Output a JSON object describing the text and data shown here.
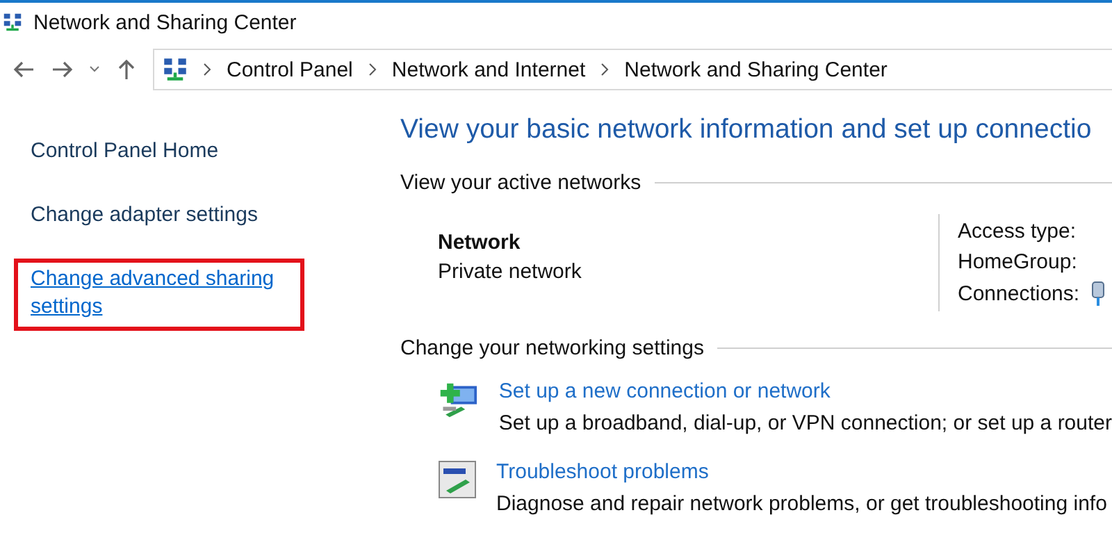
{
  "window": {
    "title": "Network and Sharing Center"
  },
  "breadcrumb": [
    "Control Panel",
    "Network and Internet",
    "Network and Sharing Center"
  ],
  "sidebar": {
    "items": [
      {
        "label": "Control Panel Home",
        "kind": "text",
        "highlighted": false
      },
      {
        "label": "Change adapter settings",
        "kind": "text",
        "highlighted": false
      },
      {
        "label": "Change advanced sharing settings",
        "kind": "link",
        "highlighted": true
      }
    ]
  },
  "main": {
    "heading": "View your basic network information and set up connectio",
    "active_section": "View your active networks",
    "network": {
      "name": "Network",
      "category": "Private network"
    },
    "details": [
      "Access type:",
      "HomeGroup:",
      "Connections:"
    ],
    "settings_section": "Change your networking settings",
    "tasks": [
      {
        "kind": "new-connection",
        "title": "Set up a new connection or network",
        "description": "Set up a broadband, dial-up, or VPN connection; or set up a router"
      },
      {
        "kind": "troubleshoot",
        "title": "Troubleshoot problems",
        "description": "Diagnose and repair network problems, or get troubleshooting info"
      }
    ]
  }
}
